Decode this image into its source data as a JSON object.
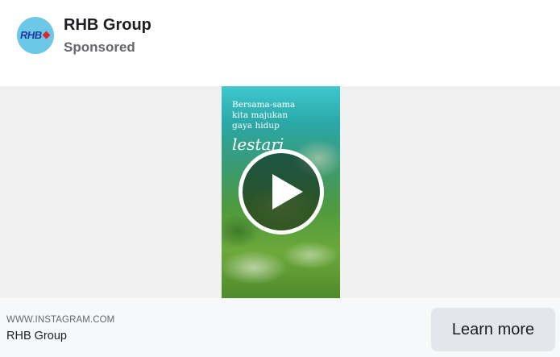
{
  "post": {
    "page_name": "RHB Group",
    "sponsored_label": "Sponsored",
    "avatar_logo_text": "RHB"
  },
  "media": {
    "overlay_lines": [
      "Bersama-sama",
      "kita majukan",
      "gaya hidup"
    ],
    "overlay_script": "lestari"
  },
  "footer": {
    "domain": "WWW.INSTAGRAM.COM",
    "title": "RHB Group",
    "cta_label": "Learn more"
  },
  "colors": {
    "avatar_bg": "#6cc8e6",
    "cta_bg": "#e4e6eb",
    "footer_bg": "#f7f8fa"
  },
  "icons": {
    "play": "play-icon"
  }
}
